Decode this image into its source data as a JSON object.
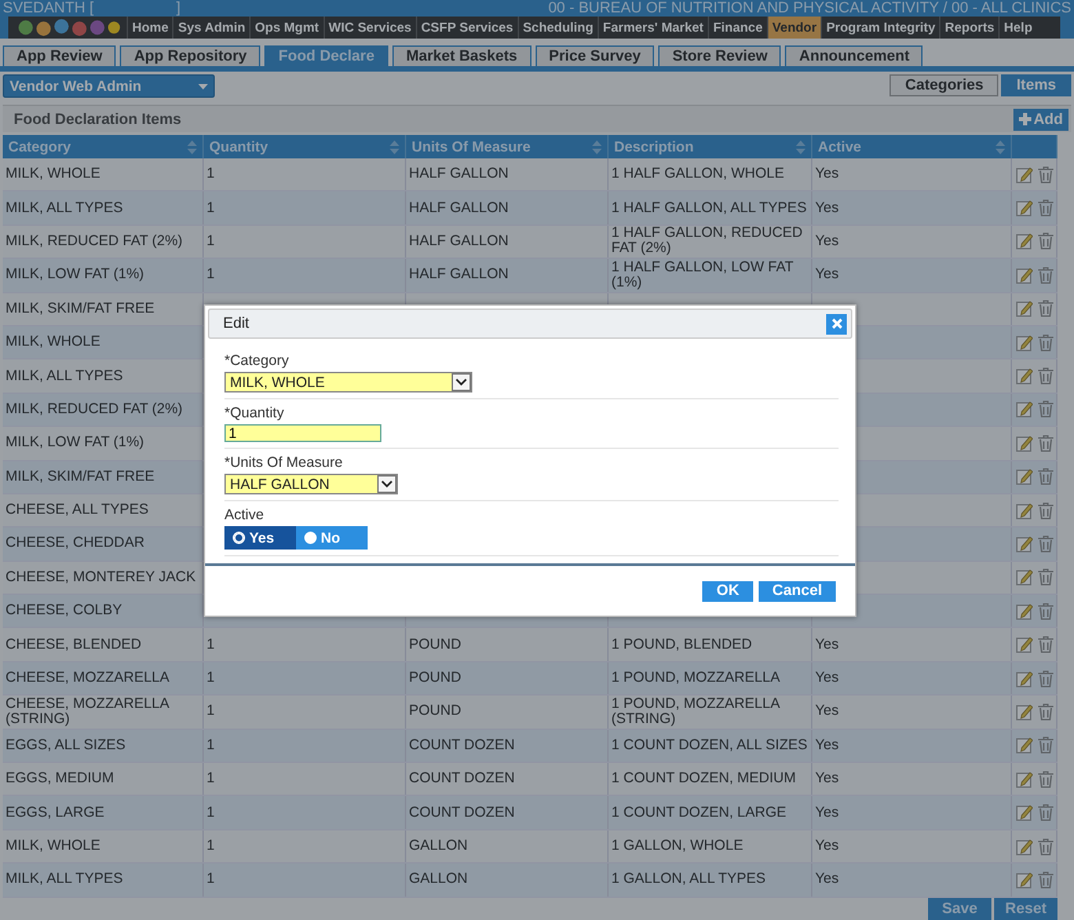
{
  "header": {
    "user": "SVEDANTH [",
    "user_end": "]",
    "agency": "00 - BUREAU OF NUTRITION AND PHYSICAL ACTIVITY / 00 - ALL CLINICS"
  },
  "menu": [
    {
      "label": "Home",
      "selected": false
    },
    {
      "label": "Sys Admin",
      "selected": false
    },
    {
      "label": "Ops Mgmt",
      "selected": false
    },
    {
      "label": "WIC Services",
      "selected": false
    },
    {
      "label": "CSFP Services",
      "selected": false
    },
    {
      "label": "Scheduling",
      "selected": false
    },
    {
      "label": "Farmers' Market",
      "selected": false
    },
    {
      "label": "Finance",
      "selected": false
    },
    {
      "label": "Vendor",
      "selected": true
    },
    {
      "label": "Program Integrity",
      "selected": false
    },
    {
      "label": "Reports",
      "selected": false
    },
    {
      "label": "Help",
      "selected": false
    }
  ],
  "tabs": [
    {
      "label": "App Review",
      "selected": false
    },
    {
      "label": "App Repository",
      "selected": false
    },
    {
      "label": "Food Declare",
      "selected": true
    },
    {
      "label": "Market Baskets",
      "selected": false
    },
    {
      "label": "Price Survey",
      "selected": false
    },
    {
      "label": "Store Review",
      "selected": false
    },
    {
      "label": "Announcement",
      "selected": false
    }
  ],
  "role_select": {
    "value": "Vendor Web Admin"
  },
  "view_tabs": [
    {
      "label": "Categories",
      "selected": false
    },
    {
      "label": "Items",
      "selected": true
    }
  ],
  "panel": {
    "title": "Food Declaration Items",
    "add_button": "Add"
  },
  "table": {
    "columns": [
      "Category",
      "Quantity",
      "Units Of Measure",
      "Description",
      "Active"
    ],
    "rows": [
      {
        "category": "MILK, WHOLE",
        "quantity": "1",
        "unit": "HALF GALLON",
        "description": "1 HALF GALLON, WHOLE",
        "active": "Yes"
      },
      {
        "category": "MILK, ALL TYPES",
        "quantity": "1",
        "unit": "HALF GALLON",
        "description": "1 HALF GALLON, ALL TYPES",
        "active": "Yes"
      },
      {
        "category": "MILK, REDUCED FAT (2%)",
        "quantity": "1",
        "unit": "HALF GALLON",
        "description": "1 HALF GALLON, REDUCED FAT (2%)",
        "active": "Yes"
      },
      {
        "category": "MILK, LOW FAT (1%)",
        "quantity": "1",
        "unit": "HALF GALLON",
        "description": "1 HALF GALLON, LOW FAT (1%)",
        "active": "Yes"
      },
      {
        "category": "MILK, SKIM/FAT FREE"
      },
      {
        "category": "MILK, WHOLE"
      },
      {
        "category": "MILK, ALL TYPES"
      },
      {
        "category": "MILK, REDUCED FAT (2%)"
      },
      {
        "category": "MILK, LOW FAT (1%)"
      },
      {
        "category": "MILK, SKIM/FAT FREE"
      },
      {
        "category": "CHEESE, ALL TYPES"
      },
      {
        "category": "CHEESE, CHEDDAR"
      },
      {
        "category": "CHEESE, MONTEREY JACK"
      },
      {
        "category": "CHEESE, COLBY"
      },
      {
        "category": "CHEESE, BLENDED",
        "quantity": "1",
        "unit": "POUND",
        "description": "1 POUND, BLENDED",
        "active": "Yes"
      },
      {
        "category": "CHEESE, MOZZARELLA",
        "quantity": "1",
        "unit": "POUND",
        "description": "1 POUND, MOZZARELLA",
        "active": "Yes"
      },
      {
        "category": "CHEESE, MOZZARELLA (STRING)",
        "quantity": "1",
        "unit": "POUND",
        "description": "1 POUND, MOZZARELLA (STRING)",
        "active": "Yes"
      },
      {
        "category": "EGGS, ALL SIZES",
        "quantity": "1",
        "unit": "COUNT DOZEN",
        "description": "1 COUNT DOZEN, ALL SIZES",
        "active": "Yes"
      },
      {
        "category": "EGGS, MEDIUM",
        "quantity": "1",
        "unit": "COUNT DOZEN",
        "description": "1 COUNT DOZEN, MEDIUM",
        "active": "Yes"
      },
      {
        "category": "EGGS, LARGE",
        "quantity": "1",
        "unit": "COUNT DOZEN",
        "description": "1 COUNT DOZEN, LARGE",
        "active": "Yes"
      },
      {
        "category": "MILK, WHOLE",
        "quantity": "1",
        "unit": "GALLON",
        "description": "1 GALLON, WHOLE",
        "active": "Yes"
      },
      {
        "category": "MILK, ALL TYPES",
        "quantity": "1",
        "unit": "GALLON",
        "description": "1 GALLON, ALL TYPES",
        "active": "Yes"
      }
    ]
  },
  "footer_buttons": [
    "Save",
    "Reset"
  ],
  "dialog": {
    "title": "Edit",
    "fields": [
      {
        "kind": "select",
        "label": "*Category",
        "value": "MILK, WHOLE"
      },
      {
        "kind": "input",
        "label": "*Quantity",
        "value": "1"
      },
      {
        "kind": "select",
        "label": "*Units Of Measure",
        "value": "HALF GALLON"
      },
      {
        "kind": "toggle",
        "label": "Active",
        "options": [
          {
            "label": "Yes",
            "selected": true
          },
          {
            "label": "No",
            "selected": false
          }
        ]
      }
    ],
    "buttons": [
      "OK",
      "Cancel"
    ]
  }
}
